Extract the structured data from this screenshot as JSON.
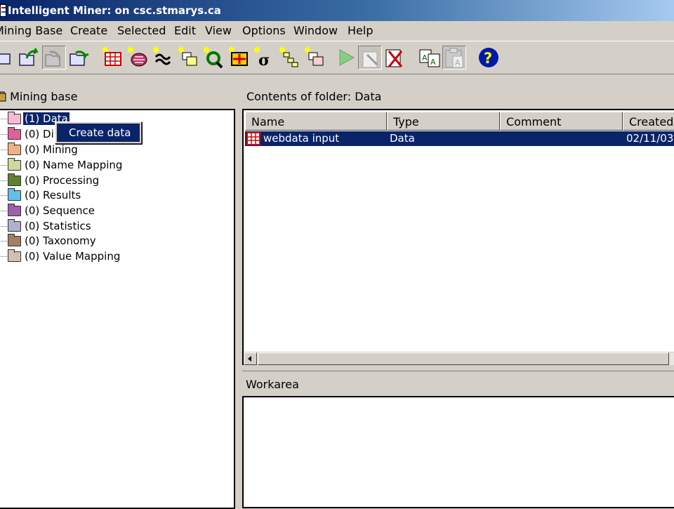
{
  "window": {
    "title": "Intelligent Miner:  on csc.stmarys.ca"
  },
  "menubar": [
    "Mining Base",
    "Create",
    "Selected",
    "Edit",
    "View",
    "Options",
    "Window",
    "Help"
  ],
  "toolbar": {
    "buttons": [
      "open-folder-icon",
      "forward-folder-icon",
      "back-folder-icon",
      "export-folder-icon",
      "new-data-icon",
      "new-discovery-icon",
      "new-mining-icon",
      "new-name-mapping-icon",
      "new-processing-icon",
      "new-results-icon",
      "new-statistics-icon",
      "new-taxonomy-icon",
      "new-value-mapping-icon",
      "run-icon",
      "edit-icon",
      "delete-icon",
      "copy-icon",
      "paste-icon",
      "help-icon"
    ]
  },
  "tree": {
    "header": "Mining base",
    "items": [
      {
        "label": "(1) Data",
        "color": "#f4b8d8"
      },
      {
        "label": "(0) Di",
        "color": "#e0609c"
      },
      {
        "label": "(0) Mining",
        "color": "#f0b080"
      },
      {
        "label": "(0) Name Mapping",
        "color": "#d0d8a0"
      },
      {
        "label": "(0) Processing",
        "color": "#608030"
      },
      {
        "label": "(0) Results",
        "color": "#60c0e8"
      },
      {
        "label": "(0) Sequence",
        "color": "#a060a8"
      },
      {
        "label": "(0) Statistics",
        "color": "#b0b0d0"
      },
      {
        "label": "(0) Taxonomy",
        "color": "#a08060"
      },
      {
        "label": "(0) Value Mapping",
        "color": "#d0c0b0"
      }
    ],
    "selected_index": 0
  },
  "context_menu": {
    "items": [
      "Create data"
    ]
  },
  "contents": {
    "header": "Contents of folder: Data",
    "columns": [
      "Name",
      "Type",
      "Comment",
      "Created"
    ],
    "rows": [
      {
        "name": "webdata input",
        "type": "Data",
        "comment": "",
        "created": "02/11/03"
      }
    ]
  },
  "workarea": {
    "header": "Workarea"
  },
  "colors": {
    "selection": "#0a246a",
    "chrome": "#d4d0c8"
  }
}
